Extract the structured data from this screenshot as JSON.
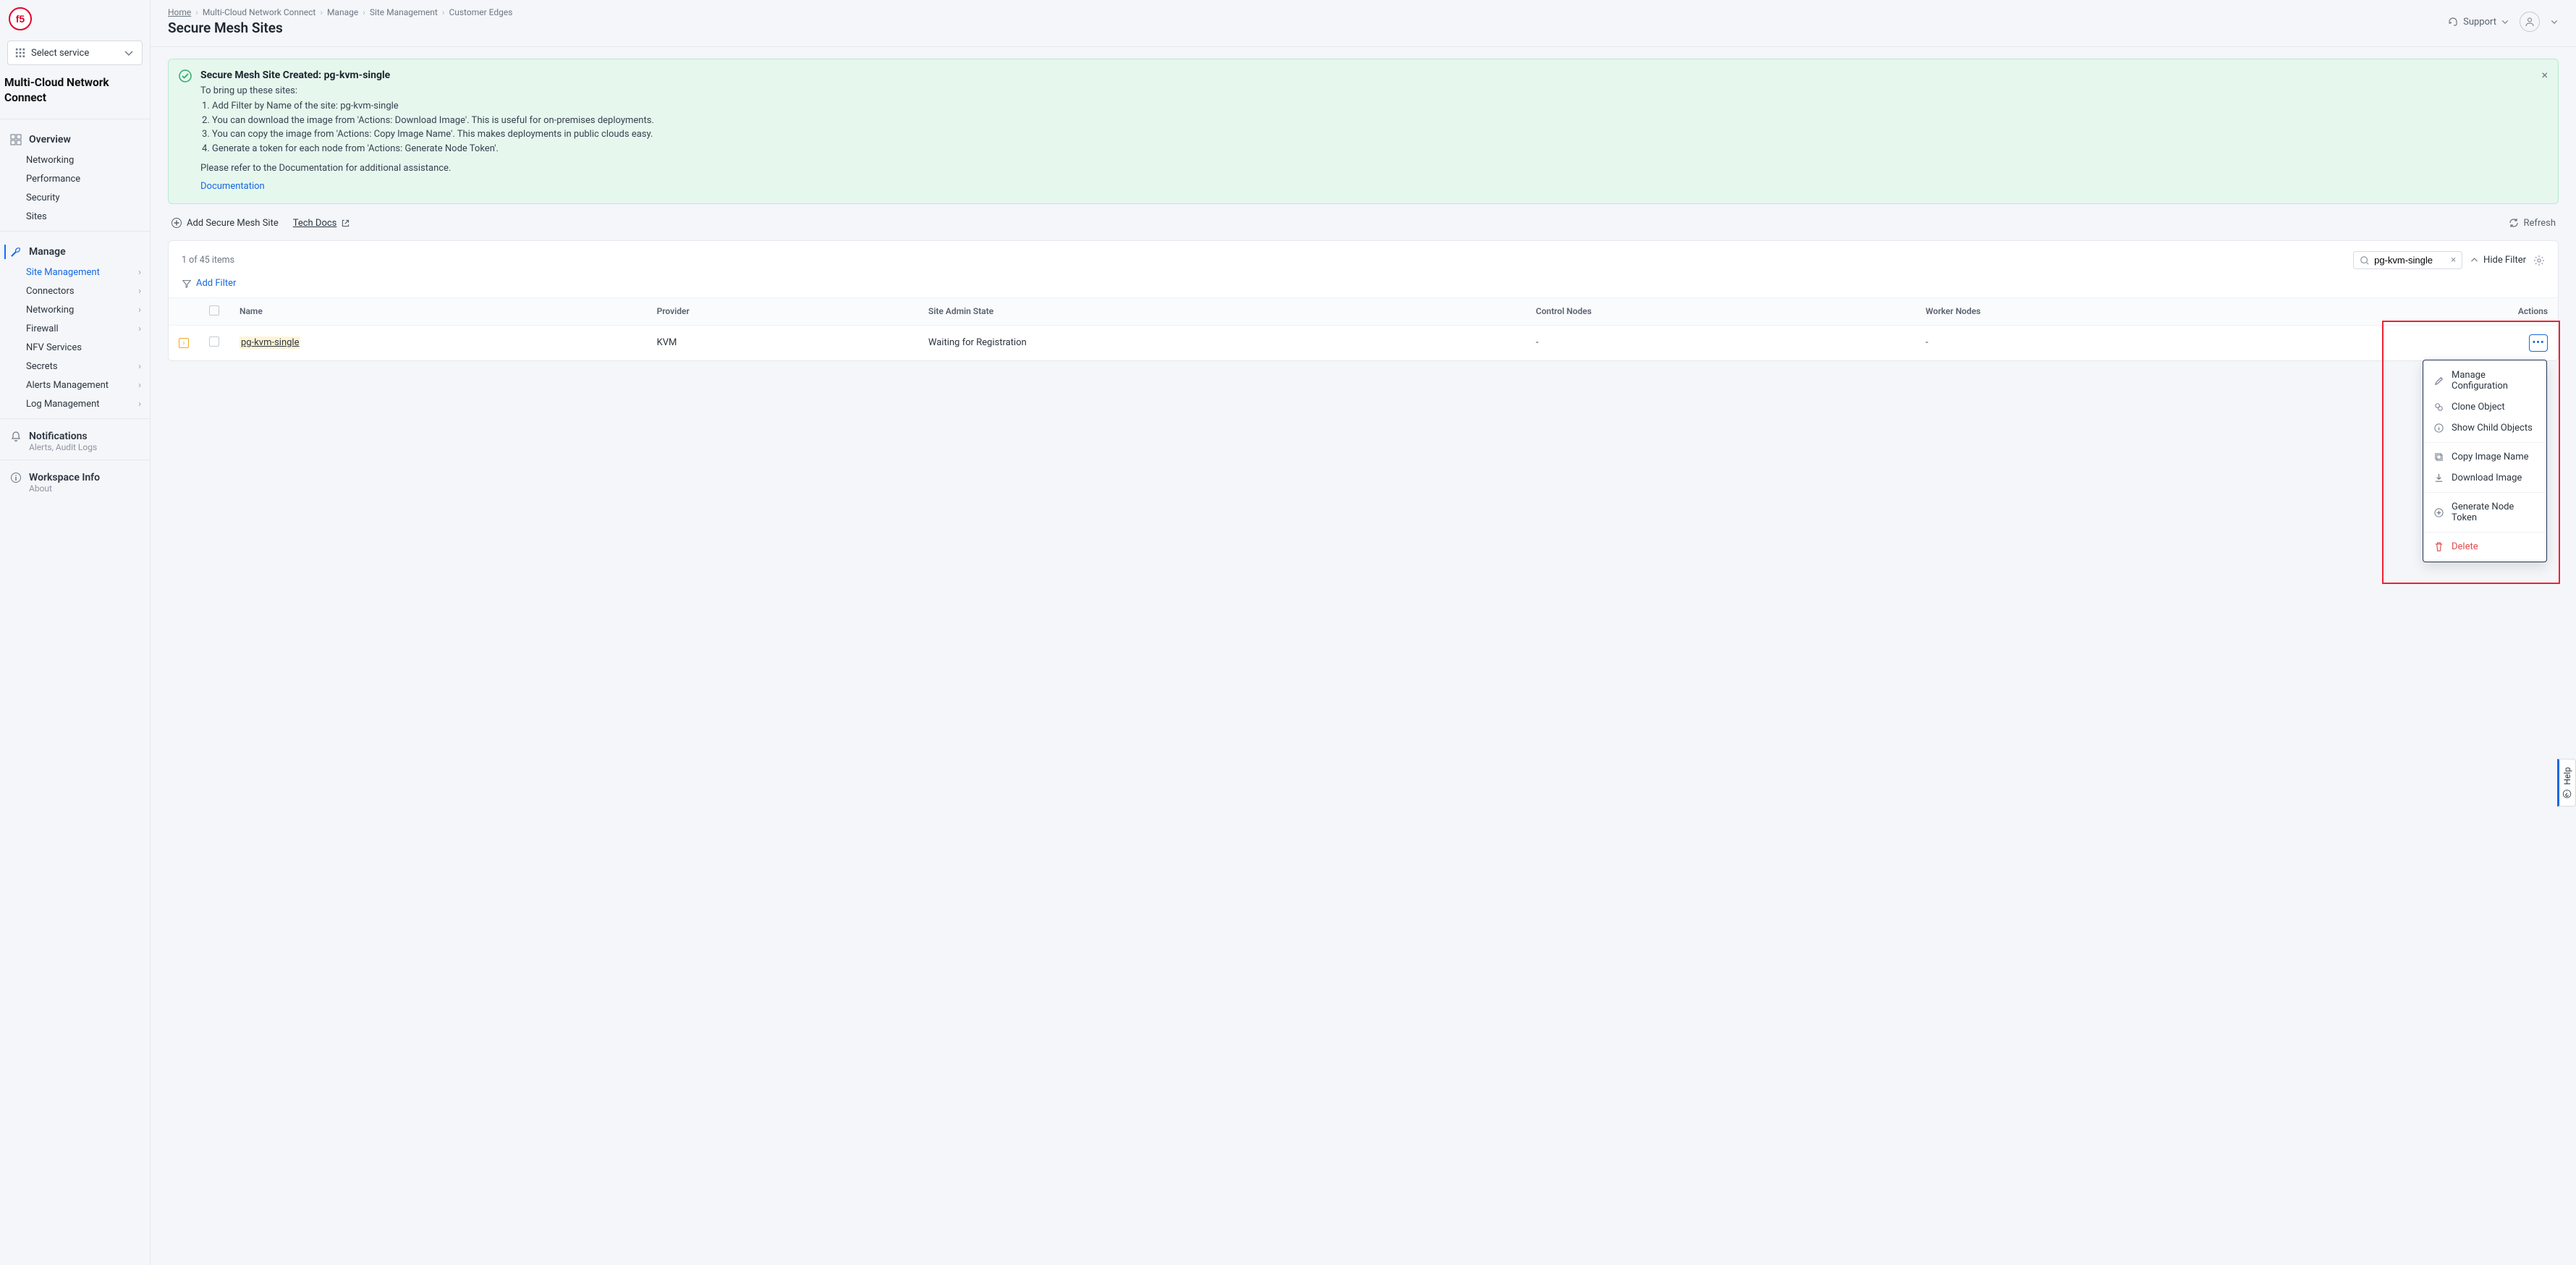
{
  "service_selector": "Select service",
  "cloud_title": "Multi-Cloud Network Connect",
  "nav": {
    "overview": "Overview",
    "overview_subs": [
      "Networking",
      "Performance",
      "Security",
      "Sites"
    ],
    "manage": "Manage",
    "manage_subs": [
      {
        "label": "Site Management",
        "selected": true,
        "chev": true
      },
      {
        "label": "Connectors",
        "chev": true
      },
      {
        "label": "Networking",
        "chev": true
      },
      {
        "label": "Firewall",
        "chev": true
      },
      {
        "label": "NFV Services",
        "chev": false
      },
      {
        "label": "Secrets",
        "chev": true
      },
      {
        "label": "Alerts Management",
        "chev": true
      },
      {
        "label": "Log Management",
        "chev": true
      }
    ]
  },
  "footer": {
    "notifications_title": "Notifications",
    "notifications_sub": "Alerts, Audit Logs",
    "workspace_title": "Workspace Info",
    "workspace_sub": "About"
  },
  "breadcrumbs": [
    "Home",
    "Multi-Cloud Network Connect",
    "Manage",
    "Site Management",
    "Customer Edges"
  ],
  "page_title": "Secure Mesh Sites",
  "top_right": {
    "support": "Support"
  },
  "alert": {
    "title": "Secure Mesh Site Created: pg-kvm-single",
    "intro": "To bring up these sites:",
    "steps": [
      "Add Filter by Name of the site: pg-kvm-single",
      "You can download the image from 'Actions: Download Image'. This is useful for on-premises deployments.",
      "You can copy the image from 'Actions: Copy Image Name'. This makes deployments in public clouds easy.",
      "Generate a token for each node from 'Actions: Generate Node Token'."
    ],
    "note": "Please refer to the Documentation for additional assistance.",
    "doc_link": "Documentation"
  },
  "toolbar": {
    "add": "Add Secure Mesh Site",
    "tech_docs": "Tech Docs",
    "refresh": "Refresh"
  },
  "panel": {
    "count": "1 of 45 items",
    "search_value": "pg-kvm-single",
    "hide_filter": "Hide Filter",
    "add_filter": "Add Filter"
  },
  "columns": [
    "",
    "",
    "Name",
    "Provider",
    "Site Admin State",
    "Control Nodes",
    "Worker Nodes",
    "Actions"
  ],
  "rows": [
    {
      "name": "pg-kvm-single",
      "provider": "KVM",
      "admin_state": "Waiting for Registration",
      "control": "-",
      "worker": "-"
    }
  ],
  "dropdown": {
    "manage": "Manage Configuration",
    "clone": "Clone Object",
    "child": "Show Child Objects",
    "copy": "Copy Image Name",
    "download": "Download Image",
    "token": "Generate Node Token",
    "delete": "Delete"
  },
  "help": "Help"
}
